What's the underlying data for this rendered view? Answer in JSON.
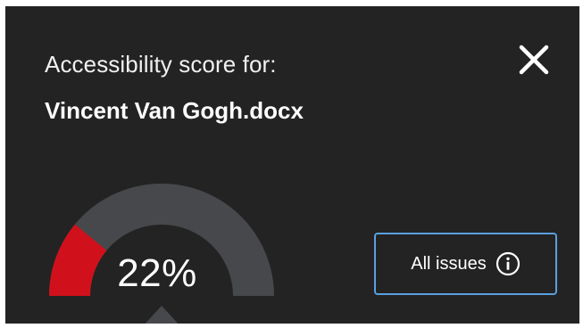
{
  "dialog": {
    "heading": "Accessibility score for:",
    "document_name": "Vincent Van Gogh.docx",
    "close_icon": "close-icon"
  },
  "score": {
    "value": 22,
    "label": "22%",
    "fill_color": "#d0111b",
    "track_color": "#47484c"
  },
  "actions": {
    "all_issues_label": "All issues",
    "info_icon": "info-icon"
  },
  "colors": {
    "panel_background": "#232323",
    "focus_border": "#5a9fe0",
    "text": "#ffffff"
  }
}
